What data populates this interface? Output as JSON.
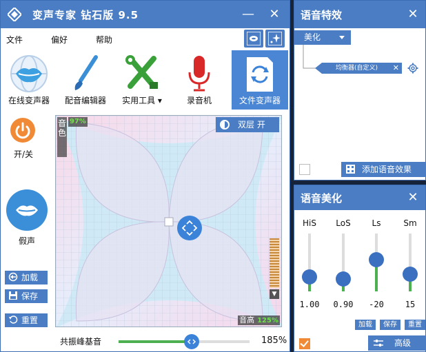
{
  "main": {
    "title": "变声专家  钻石版  9.5",
    "menu": [
      "文件",
      "偏好",
      "帮助"
    ],
    "tools": [
      {
        "label": "在线变声器",
        "icon": "lips-globe-icon"
      },
      {
        "label": "配音编辑器",
        "icon": "paintbrush-icon"
      },
      {
        "label": "实用工具",
        "icon": "tools-icon"
      },
      {
        "label": "录音机",
        "icon": "microphone-icon"
      },
      {
        "label": "文件变声器",
        "icon": "file-convert-icon"
      }
    ],
    "power_label": "开/关",
    "fake_label": "假声",
    "side_buttons": [
      "加载",
      "保存",
      "重置"
    ],
    "pad": {
      "tone_label": "音色",
      "tone_value": "97%",
      "dual_label": "双层 开",
      "pitch_label": "音高",
      "pitch_value": "125%",
      "pitch_percent": 125,
      "tone_percent": 97
    },
    "resonance_label": "共振峰基音",
    "resonance_value": "185%",
    "resonance_fraction": 0.56
  },
  "effects": {
    "title": "语音特效",
    "dropdown_value": "美化",
    "node_label": "均衡器(自定义)",
    "add_label": "添加语音效果",
    "enabled": false
  },
  "beautify": {
    "title": "语音美化",
    "sliders": [
      {
        "name": "HiS",
        "value": "1.00",
        "level": 0.25
      },
      {
        "name": "LoS",
        "value": "0.90",
        "level": 0.22
      },
      {
        "name": "Ls",
        "value": "-20",
        "level": 0.55
      },
      {
        "name": "Sm",
        "value": "15",
        "level": 0.3
      }
    ],
    "buttons": [
      "加载",
      "保存",
      "重置"
    ],
    "advanced_label": "高级",
    "enabled": true
  },
  "colors": {
    "accent": "#4a7dc4",
    "active_tool": "#4a86d4",
    "orange": "#f08a36",
    "green": "#4caf50"
  }
}
